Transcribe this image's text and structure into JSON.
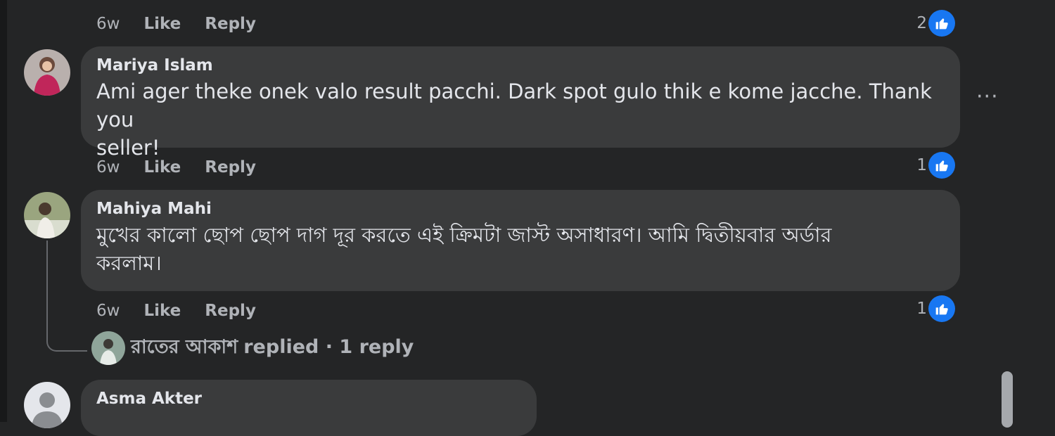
{
  "comments": [
    {
      "meta": {
        "time": "6w",
        "like": "Like",
        "reply": "Reply"
      },
      "reactions": {
        "count": "2",
        "icon": "like-icon"
      }
    },
    {
      "author": "Mariya Islam",
      "text_line1": "Ami ager theke onek valo result pacchi. Dark spot gulo thik e kome jacche. Thank you",
      "text_line2": "seller!",
      "more": "···",
      "meta": {
        "time": "6w",
        "like": "Like",
        "reply": "Reply"
      },
      "reactions": {
        "count": "1",
        "icon": "like-icon"
      }
    },
    {
      "author": "Mahiya Mahi",
      "text_line1": "মুখের কালো ছোপ ছোপ দাগ দূর করতে এই ক্রিমটা জাস্ট অসাধারণ। আমি দ্বিতীয়বার অর্ডার",
      "text_line2": "করলাম।",
      "meta": {
        "time": "6w",
        "like": "Like",
        "reply": "Reply"
      },
      "reactions": {
        "count": "1",
        "icon": "like-icon"
      },
      "replies": {
        "name": "রাতের আকাশ",
        "summary": "replied · 1 reply"
      }
    },
    {
      "author": "Asma Akter"
    }
  ],
  "colors": {
    "background": "#242526",
    "bubble": "#3a3b3c",
    "accent": "#1877f2",
    "secondary_text": "#b0b3b8"
  }
}
